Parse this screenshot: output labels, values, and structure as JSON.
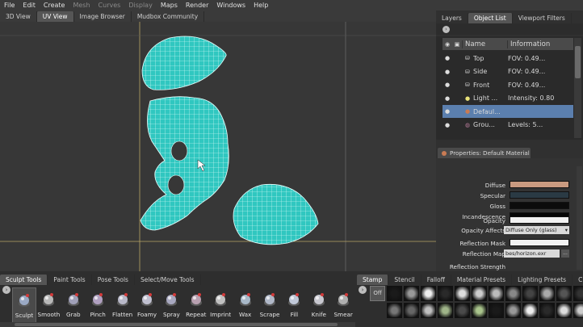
{
  "menu": [
    "File",
    "Edit",
    "Create",
    "Mesh",
    "Curves",
    "Display",
    "Maps",
    "Render",
    "Windows",
    "Help"
  ],
  "menu_disabled": [
    "Mesh",
    "Curves",
    "Display"
  ],
  "view_tabs": [
    "3D View",
    "UV View",
    "Image Browser",
    "Mudbox Community"
  ],
  "active_view_tab": "UV View",
  "right_tabs": [
    "Layers",
    "Object List",
    "Viewport Filters"
  ],
  "active_right_tab": "Object List",
  "object_list": {
    "columns": [
      "Name",
      "Information"
    ],
    "rows": [
      {
        "name": "Top",
        "info": "FOV: 0.49...",
        "icon": "camera-icon"
      },
      {
        "name": "Side",
        "info": "FOV: 0.49...",
        "icon": "camera-icon"
      },
      {
        "name": "Front",
        "info": "FOV: 0.49...",
        "icon": "camera-icon"
      },
      {
        "name": "Light ...",
        "info": "Intensity: 0.80",
        "icon": "light-bulb-icon"
      },
      {
        "name": "Defaul...",
        "info": "",
        "icon": "material-icon",
        "selected": true
      },
      {
        "name": "Grou...",
        "info": "Levels: 5...",
        "icon": "mesh-icon"
      }
    ]
  },
  "properties": {
    "title": "Properties: Default Material",
    "fields": [
      {
        "label": "Diffuse",
        "color": "#c99a80"
      },
      {
        "label": "Specular",
        "color": "#2a3a44"
      },
      {
        "label": "Gloss",
        "color": "#0c0c0c"
      },
      {
        "label": "Incandescence",
        "color": "#060606"
      },
      {
        "label": "Opacity",
        "color": "#f2f2f2"
      }
    ],
    "opacity_affects_label": "Opacity Affects",
    "opacity_affects_value": "Diffuse Only (glass)",
    "reflection_mask_label": "Reflection Mask",
    "reflection_map_label": "Reflection Map",
    "reflection_map_value": "bes/horizon.exr",
    "reflection_map_button": "...",
    "reflection_strength_label": "Reflection Strength"
  },
  "sculpt_tabs": [
    "Sculpt Tools",
    "Paint Tools",
    "Pose Tools",
    "Select/Move Tools"
  ],
  "active_sculpt_tab": "Sculpt Tools",
  "tools": [
    "Sculpt",
    "Smooth",
    "Grab",
    "Pinch",
    "Flatten",
    "Foamy",
    "Spray",
    "Repeat",
    "Imprint",
    "Wax",
    "Scrape",
    "Fill",
    "Knife",
    "Smear"
  ],
  "stamp_tabs": [
    "Stamp",
    "Stencil",
    "Falloff",
    "Material Presets",
    "Lighting Presets",
    "C"
  ],
  "active_stamp_tab": "Stamp",
  "stamp_off_label": "Off",
  "colors": {
    "uv_mesh": "#3ee8e0",
    "selection": "#5b7fae",
    "accent": "#c8b06e"
  }
}
